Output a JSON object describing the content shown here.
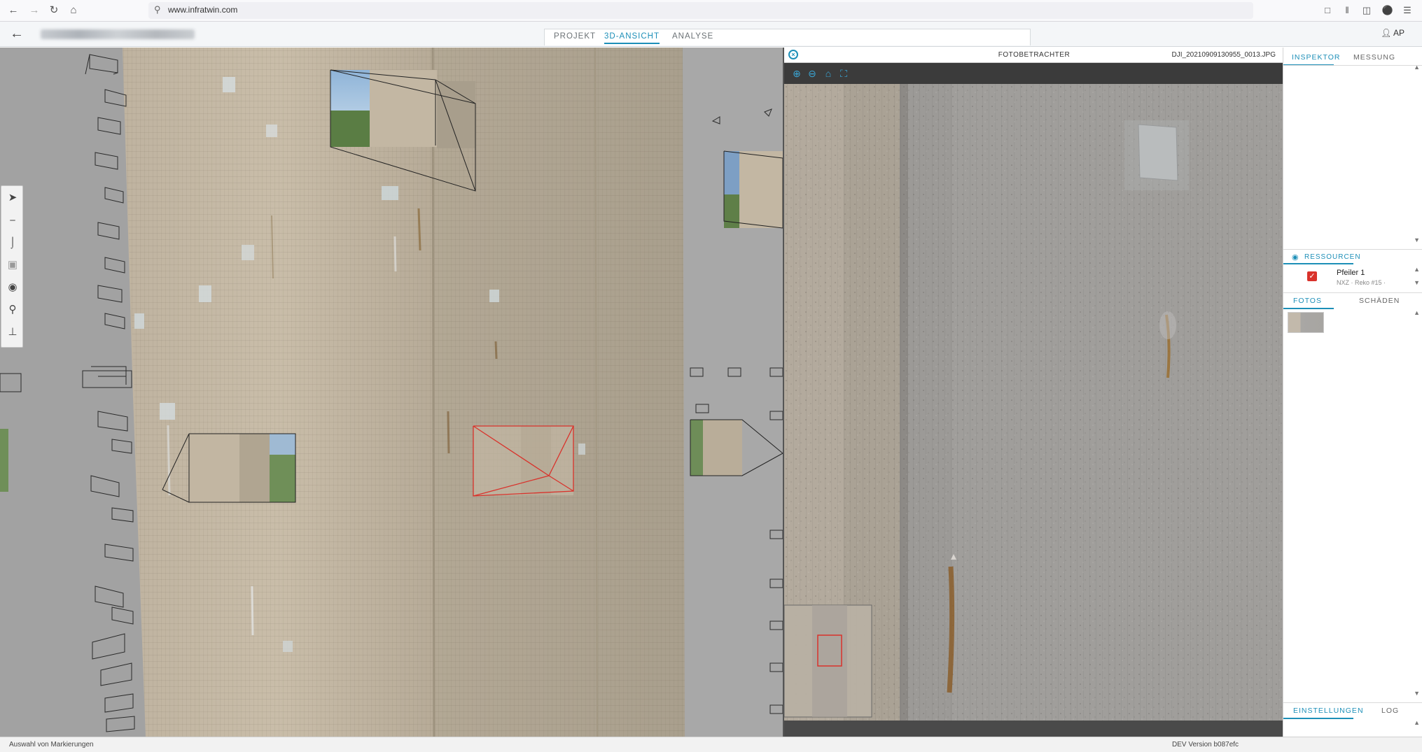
{
  "browser": {
    "url": "www.infratwin.com",
    "nav_icons": [
      "back-icon",
      "forward-icon",
      "reload-icon",
      "home-icon"
    ],
    "toolbar_icons": [
      "pocket-icon",
      "library-icon",
      "sidebar-icon",
      "extension-shield-icon",
      "menu-icon"
    ]
  },
  "header": {
    "tabs": [
      {
        "label": "PROJEKT",
        "active": false
      },
      {
        "label": "3D-ANSICHT",
        "active": true
      },
      {
        "label": "ANALYSE",
        "active": false
      }
    ],
    "user_initials": "AP"
  },
  "viewport": {
    "tools": [
      "select-cursor-icon",
      "measure-ruler-icon",
      "area-ruler-icon",
      "focus-scan-icon",
      "camera-icon",
      "location-pin-icon",
      "axis-gizmo-icon"
    ]
  },
  "photo_viewer": {
    "title": "FOTOBETRACHTER",
    "filename": "DJI_20210909130955_0013.JPG",
    "tools": [
      "zoom-in-icon",
      "zoom-out-icon",
      "home-view-icon",
      "fullscreen-icon"
    ]
  },
  "sidebar": {
    "top_tabs": [
      "INSPEKTOR",
      "MESSUNG"
    ],
    "resources_label": "RESSOURCEN",
    "resource": {
      "name": "Pfeiler 1",
      "meta": "NXZ · Reko #15 ·",
      "checked": true
    },
    "media_tabs": [
      "FOTOS",
      "SCHÄDEN"
    ],
    "bottom_tabs": [
      "EINSTELLUNGEN",
      "LOG"
    ]
  },
  "status": {
    "left": "Auswahl von Markierungen",
    "right": "DEV Version b087efc"
  },
  "colors": {
    "accent": "#1d8fb8",
    "selection_red": "#d9322b"
  }
}
